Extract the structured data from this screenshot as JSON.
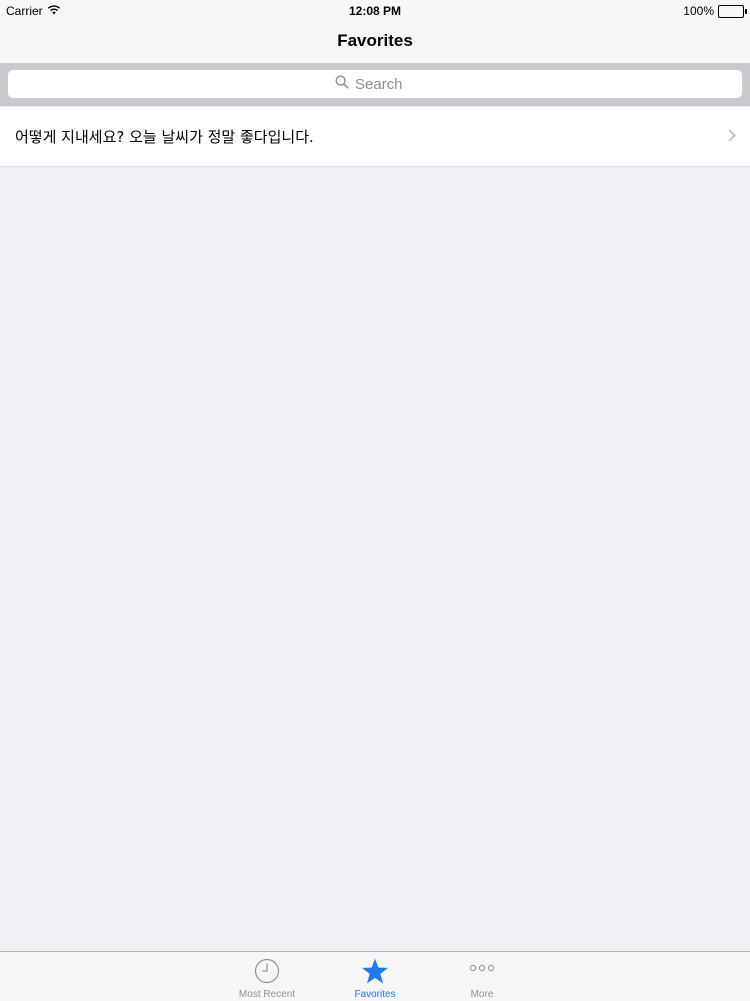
{
  "status_bar": {
    "carrier": "Carrier",
    "time": "12:08 PM",
    "battery_percent": "100%",
    "battery_level": 1.0
  },
  "nav": {
    "title": "Favorites"
  },
  "search": {
    "placeholder": "Search",
    "value": ""
  },
  "list": {
    "items": [
      {
        "label": "어떻게 지내세요? 오늘 날씨가 정말 좋다입니다."
      }
    ]
  },
  "tabbar": {
    "tabs": [
      {
        "label": "Most Recent",
        "icon": "clock-icon",
        "active": false
      },
      {
        "label": "Favorites",
        "icon": "star-icon",
        "active": true
      },
      {
        "label": "More",
        "icon": "more-icon",
        "active": false
      }
    ]
  },
  "colors": {
    "accent": "#1b7cf6",
    "inactive": "#929292",
    "background": "#efeff4",
    "bar": "#f7f7f7",
    "search_bar_background": "#c9c9ce"
  }
}
